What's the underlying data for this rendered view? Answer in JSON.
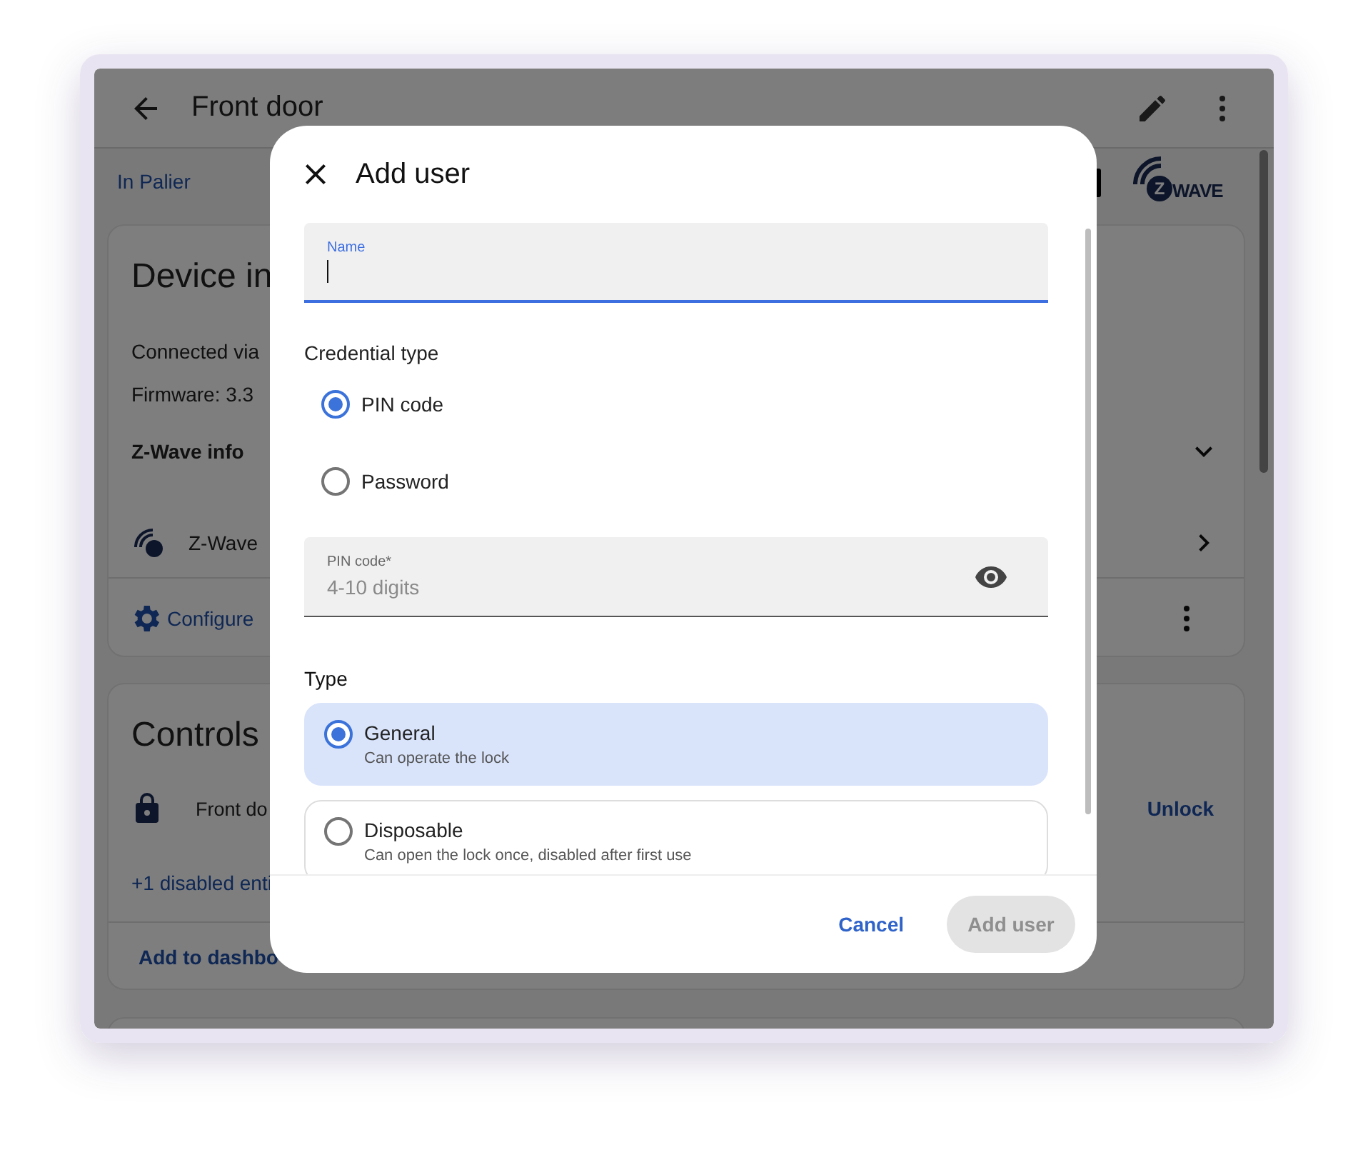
{
  "app_bar": {
    "title": "Front door"
  },
  "area_link": "In Palier",
  "zwave_logo": {
    "badge": "Z",
    "word": "WAVE"
  },
  "device_card": {
    "title": "Device in",
    "connected_via": "Connected via",
    "firmware": "Firmware: 3.3",
    "section": "Z-Wave info",
    "integration": "Z-Wave",
    "configure": "Configure"
  },
  "controls_card": {
    "title": "Controls",
    "entity": "Front do",
    "action": "Unlock",
    "disabled_link": "+1 disabled enti",
    "add_button": "Add to dashbo"
  },
  "dialog": {
    "title": "Add user",
    "name_field": {
      "label": "Name",
      "focused": true
    },
    "credential_type": {
      "label": "Credential type",
      "options": [
        {
          "label": "PIN code",
          "selected": true
        },
        {
          "label": "Password",
          "selected": false
        }
      ]
    },
    "pin_field": {
      "label": "PIN code*",
      "placeholder": "4-10 digits"
    },
    "type": {
      "label": "Type",
      "options": [
        {
          "title": "General",
          "description": "Can operate the lock",
          "selected": true
        },
        {
          "title": "Disposable",
          "description": "Can open the lock once, disabled after first use",
          "selected": false
        }
      ]
    },
    "cancel": "Cancel",
    "submit": {
      "label": "Add user",
      "disabled": true
    }
  }
}
